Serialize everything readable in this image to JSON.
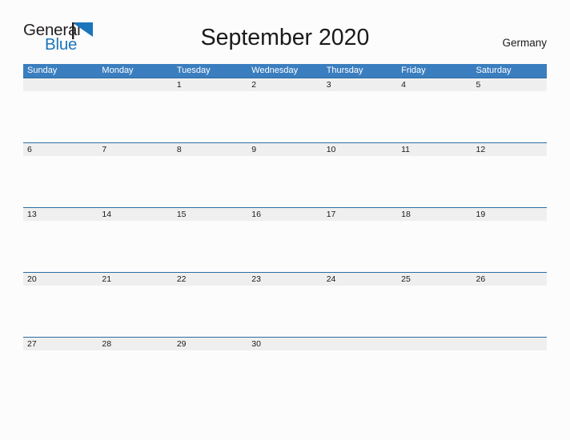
{
  "brand": {
    "name_part1": "General",
    "name_part2": "Blue",
    "flag_icon": "blue-triangle-flag-icon",
    "color_dark": "#231f20",
    "color_blue": "#1b75bb"
  },
  "header": {
    "title": "September 2020",
    "country": "Germany"
  },
  "calendar": {
    "month": "September",
    "year": "2020",
    "accent_header_color": "#3a7ebf",
    "row_band_color": "#efefef",
    "row_divider_color": "#2e6da4",
    "weekdays": [
      "Sunday",
      "Monday",
      "Tuesday",
      "Wednesday",
      "Thursday",
      "Friday",
      "Saturday"
    ],
    "weeks": [
      [
        "",
        "",
        "1",
        "2",
        "3",
        "4",
        "5"
      ],
      [
        "6",
        "7",
        "8",
        "9",
        "10",
        "11",
        "12"
      ],
      [
        "13",
        "14",
        "15",
        "16",
        "17",
        "18",
        "19"
      ],
      [
        "20",
        "21",
        "22",
        "23",
        "24",
        "25",
        "26"
      ],
      [
        "27",
        "28",
        "29",
        "30",
        "",
        "",
        ""
      ]
    ]
  }
}
